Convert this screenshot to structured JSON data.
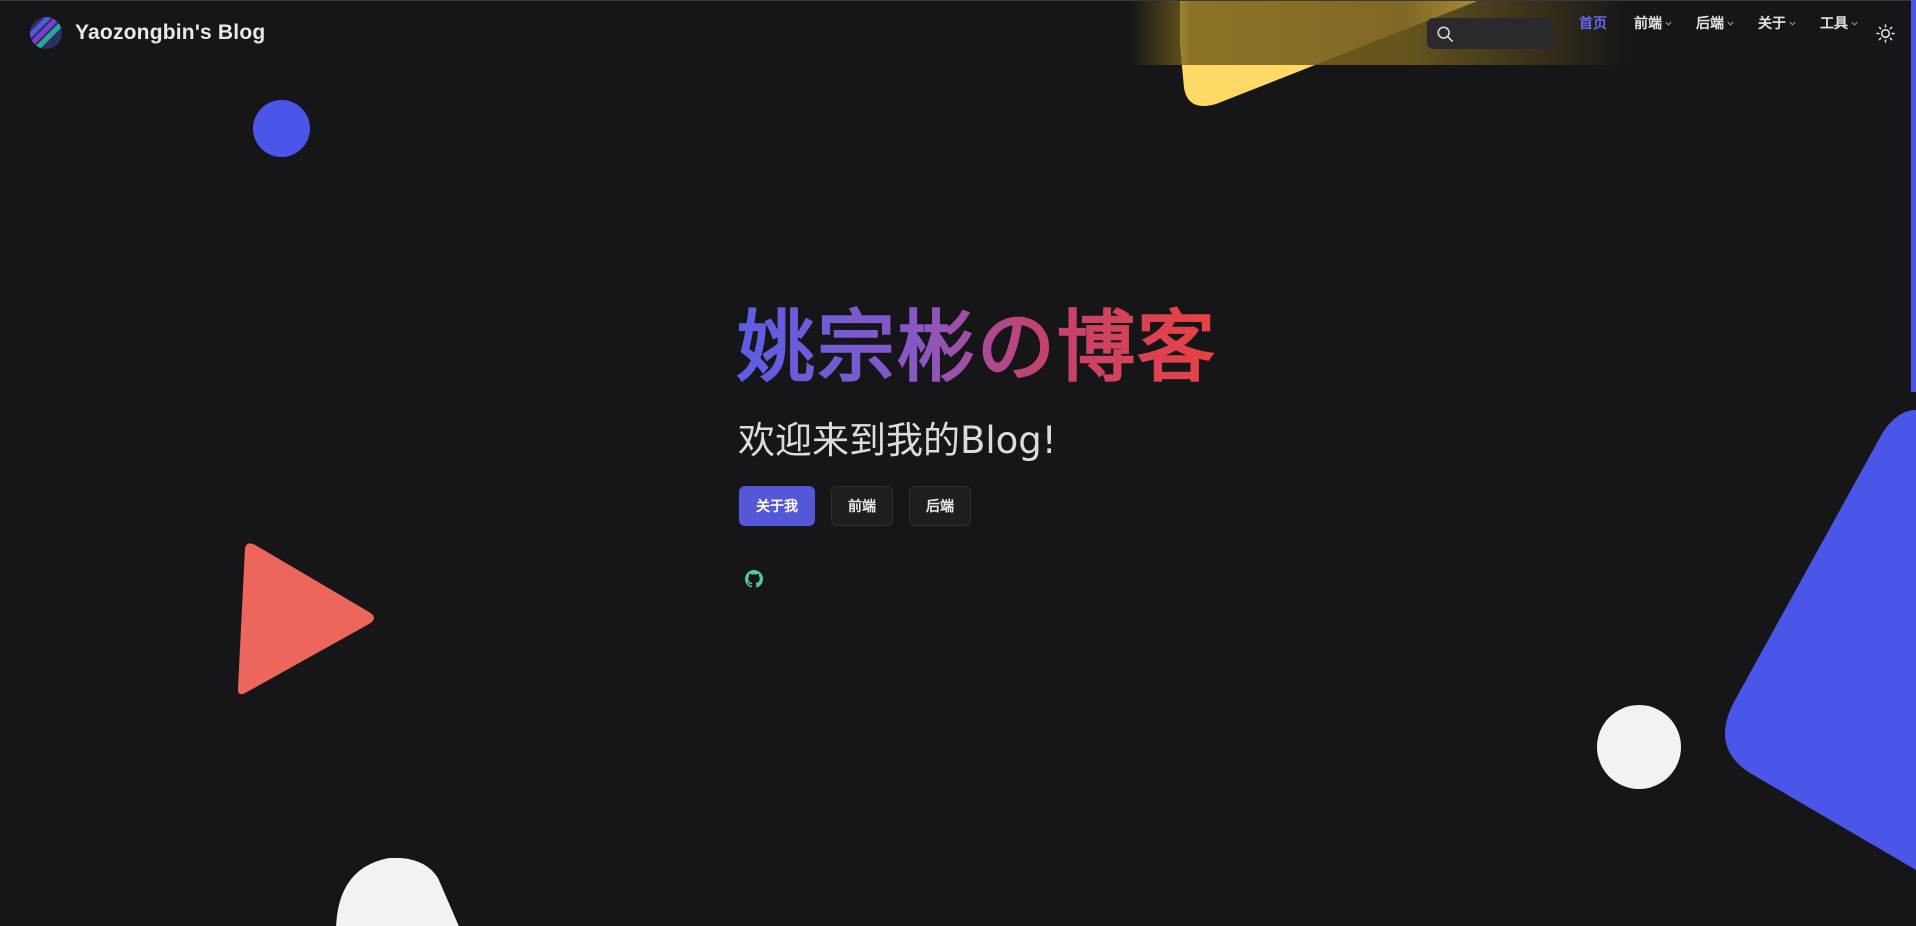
{
  "header": {
    "brand_name": "Yaozongbin's Blog",
    "search": {
      "placeholder": ""
    },
    "nav": {
      "home": "首页",
      "frontend": "前端",
      "backend": "后端",
      "about": "关于",
      "tools": "工具"
    }
  },
  "hero": {
    "title": "姚宗彬の博客",
    "subtitle": "欢迎来到我的Blog!",
    "buttons": {
      "about_me": "关于我",
      "frontend": "前端",
      "backend": "后端"
    }
  },
  "colors": {
    "background": "#161618",
    "accent": "#6366f1",
    "primary_button": "#5558d6",
    "shape_blue": "#4a56e8",
    "shape_red": "#ec665c",
    "shape_yellow": "#ffd866",
    "shape_white": "#f1f2f4",
    "github_icon": "#4ec9a0"
  },
  "icons": {
    "logo": "blog-logo-icon",
    "search": "search-icon",
    "theme": "sun-icon",
    "github": "github-icon"
  }
}
